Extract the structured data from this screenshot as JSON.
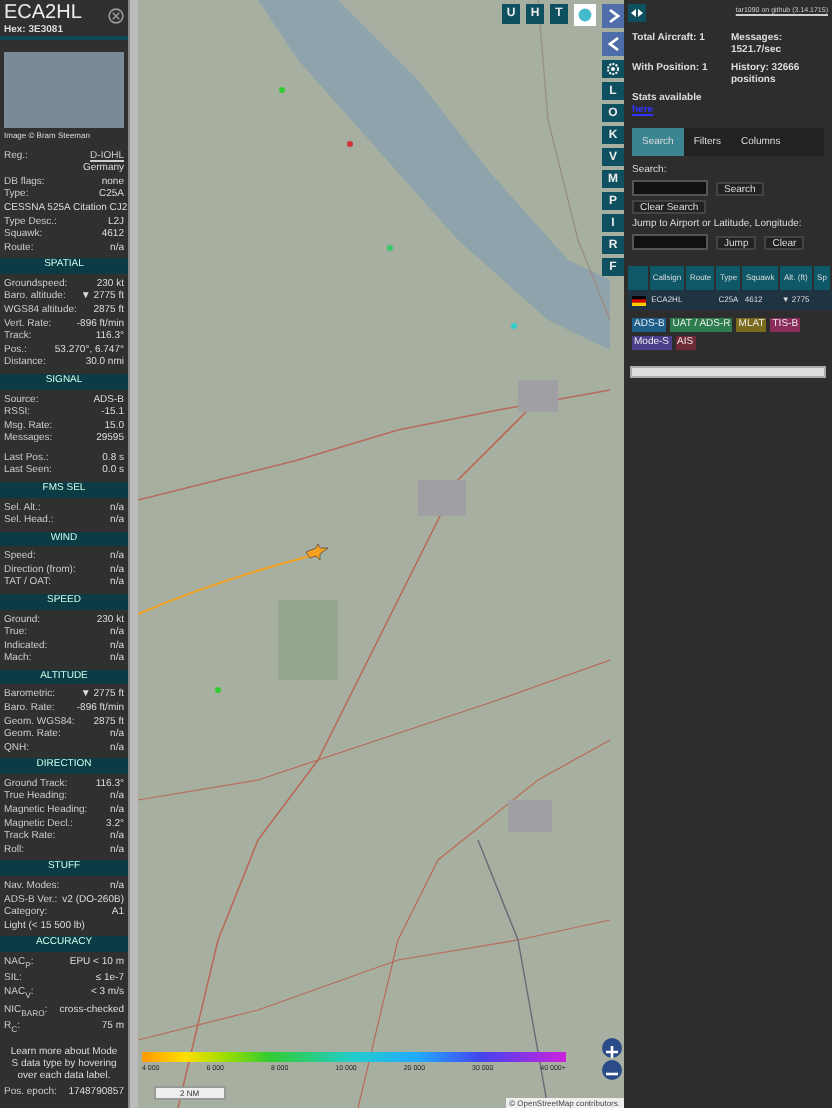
{
  "detail": {
    "callsign": "ECA2HL",
    "hex_label": "Hex:",
    "hex": "3E3081",
    "photo_credit": "Image © Bram Steeman",
    "info": [
      {
        "kind": "link",
        "label": "Reg.:",
        "value": "D-IOHL"
      },
      {
        "kind": "value",
        "value": "Germany"
      },
      {
        "kind": "pair",
        "label": "DB flags:",
        "value": "none"
      },
      {
        "kind": "pair",
        "label": "Type:",
        "value": "C25A"
      },
      {
        "kind": "text",
        "value": "CESSNA 525A Citation CJ2"
      },
      {
        "kind": "pair",
        "label": "Type Desc.:",
        "value": "L2J"
      },
      {
        "kind": "pair",
        "label": "Squawk:",
        "value": "4612"
      },
      {
        "kind": "pair",
        "label": "Route:",
        "value": "n/a"
      }
    ],
    "sections": [
      {
        "title": "SPATIAL",
        "groups": [
          [
            {
              "kind": "pair",
              "label": "Groundspeed:",
              "value": "230 kt"
            },
            {
              "kind": "pair",
              "label": "Baro. altitude:",
              "value": "▼ 2775 ft"
            },
            {
              "kind": "pair",
              "label": "WGS84 altitude:",
              "value": "2875 ft"
            },
            {
              "kind": "pair",
              "label": "Vert. Rate:",
              "value": "-896 ft/min"
            },
            {
              "kind": "pair",
              "label": "Track:",
              "value": "116.3°"
            },
            {
              "kind": "pair",
              "label": "Pos.:",
              "value": "53.270°, 6.747°"
            },
            {
              "kind": "pair",
              "label": "Distance:",
              "value": "30.0 nmi"
            }
          ]
        ]
      },
      {
        "title": "SIGNAL",
        "groups": [
          [
            {
              "kind": "pair",
              "label": "Source:",
              "value": "ADS-B"
            },
            {
              "kind": "pair",
              "label": "RSSI:",
              "value": "-15.1"
            },
            {
              "kind": "pair",
              "label": "Msg. Rate:",
              "value": "15.0"
            },
            {
              "kind": "pair",
              "label": "Messages:",
              "value": "29595"
            }
          ],
          [
            {
              "kind": "pair",
              "label": "Last Pos.:",
              "value": "0.8 s"
            },
            {
              "kind": "pair",
              "label": "Last Seen:",
              "value": "0.0 s"
            }
          ]
        ]
      },
      {
        "title": "FMS SEL",
        "groups": [
          [
            {
              "kind": "pair",
              "label": "Sel. Alt.:",
              "value": "n/a"
            },
            {
              "kind": "pair",
              "label": "Sel. Head.:",
              "value": "n/a"
            }
          ]
        ]
      },
      {
        "title": "WIND",
        "groups": [
          [
            {
              "kind": "pair",
              "label": "Speed:",
              "value": "n/a"
            },
            {
              "kind": "pair",
              "label": "Direction (from):",
              "value": "n/a"
            },
            {
              "kind": "pair",
              "label": "TAT / OAT:",
              "value": "n/a"
            }
          ]
        ]
      },
      {
        "title": "SPEED",
        "groups": [
          [
            {
              "kind": "pair",
              "label": "Ground:",
              "value": "230 kt"
            },
            {
              "kind": "pair",
              "label": "True:",
              "value": "n/a"
            },
            {
              "kind": "pair",
              "label": "Indicated:",
              "value": "n/a"
            },
            {
              "kind": "pair",
              "label": "Mach:",
              "value": "n/a"
            }
          ]
        ]
      },
      {
        "title": "ALTITUDE",
        "groups": [
          [
            {
              "kind": "pair",
              "label": "Barometric:",
              "value": "▼ 2775 ft"
            },
            {
              "kind": "pair",
              "label": "Baro. Rate:",
              "value": "-896 ft/min"
            },
            {
              "kind": "pair",
              "label": "Geom. WGS84:",
              "value": "2875 ft"
            },
            {
              "kind": "pair",
              "label": "Geom. Rate:",
              "value": "n/a"
            },
            {
              "kind": "pair",
              "label": "QNH:",
              "value": "n/a"
            }
          ]
        ]
      },
      {
        "title": "DIRECTION",
        "groups": [
          [
            {
              "kind": "pair",
              "label": "Ground Track:",
              "value": "116.3°"
            },
            {
              "kind": "pair",
              "label": "True Heading:",
              "value": "n/a"
            },
            {
              "kind": "pair",
              "label": "Magnetic Heading:",
              "value": "n/a"
            },
            {
              "kind": "pair",
              "label": "Magnetic Decl.:",
              "value": "3.2°"
            },
            {
              "kind": "pair",
              "label": "Track Rate:",
              "value": "n/a"
            },
            {
              "kind": "pair",
              "label": "Roll:",
              "value": "n/a"
            }
          ]
        ]
      },
      {
        "title": "STUFF",
        "groups": [
          [
            {
              "kind": "pair",
              "label": "Nav. Modes:",
              "value": "n/a"
            },
            {
              "kind": "pair",
              "label": "ADS-B Ver.:",
              "value": "v2 (DO-260B)"
            },
            {
              "kind": "pair",
              "label": "Category:",
              "value": "A1"
            },
            {
              "kind": "text",
              "value": "Light (< 15 500 lb)"
            }
          ]
        ]
      },
      {
        "title": "ACCURACY",
        "groups": [
          [
            {
              "kind": "pair",
              "label": "NAC$_{P}$:",
              "value": "EPU < 10 m"
            },
            {
              "kind": "pair",
              "label": "SIL:",
              "value": "≤ 1e-7"
            },
            {
              "kind": "pair",
              "label": "NAC$_{V}$:",
              "value": "< 3 m/s"
            },
            {
              "kind": "pair",
              "label": "NIC$_{BARO}$:",
              "value": "cross-checked"
            },
            {
              "kind": "pair",
              "label": "R$_{C}$:",
              "value": "75 m"
            }
          ]
        ]
      }
    ],
    "note": "Learn more about Mode S data type by hovering over each data label.",
    "epoch_label": "Pos. epoch:",
    "epoch": "1748790857"
  },
  "map": {
    "top_buttons": [
      "U",
      "H",
      "T"
    ],
    "side_buttons": [
      "L",
      "O",
      "K",
      "V",
      "M",
      "P",
      "I",
      "R",
      "F"
    ],
    "legend_labels": [
      "4 000",
      "6 000",
      "8 000",
      "10 000",
      "20 000",
      "30 000",
      "40 000+"
    ],
    "scale": "2 NM",
    "attribution": "© OpenStreetMap contributors."
  },
  "panel": {
    "version_link": "tar1090 on github (3.14.1715)",
    "stats": [
      {
        "label": "Total Aircraft:",
        "value": "1"
      },
      {
        "label": "Messages:",
        "value": "1521.7/sec"
      },
      {
        "label": "With Position:",
        "value": "1"
      },
      {
        "label": "History:",
        "value": "32666 positions"
      }
    ],
    "stats_text": "Stats available",
    "stats_link": "here",
    "tabs": [
      {
        "label": "Search",
        "selected": true
      },
      {
        "label": "Filters",
        "selected": false
      },
      {
        "label": "Columns",
        "selected": false
      }
    ],
    "search_label": "Search:",
    "search_button": "Search",
    "clear_search_button": "Clear Search",
    "jump_label": "Jump to Airport or Latitude, Longitude:",
    "jump_button": "Jump",
    "clear_button": "Clear",
    "columns": [
      "Callsign",
      "Route",
      "Type",
      "Squawk",
      "Alt. (ft)",
      "Sp"
    ],
    "rows": [
      {
        "callsign": "ECA2HL",
        "type": "C25A",
        "squawk": "4612",
        "altitude": "▼ 2775"
      }
    ],
    "legend": [
      {
        "label": "ADS-B",
        "color": "#1d5f8a"
      },
      {
        "label": "UAT / ADS-R",
        "color": "#2e7d4f"
      },
      {
        "label": "MLAT",
        "color": "#7a6a1e"
      },
      {
        "label": "TIS-B",
        "color": "#8a2d5a"
      },
      {
        "label": "Mode-S",
        "color": "#4a3f8a"
      },
      {
        "label": "AIS",
        "color": "#6e2a36"
      }
    ]
  }
}
